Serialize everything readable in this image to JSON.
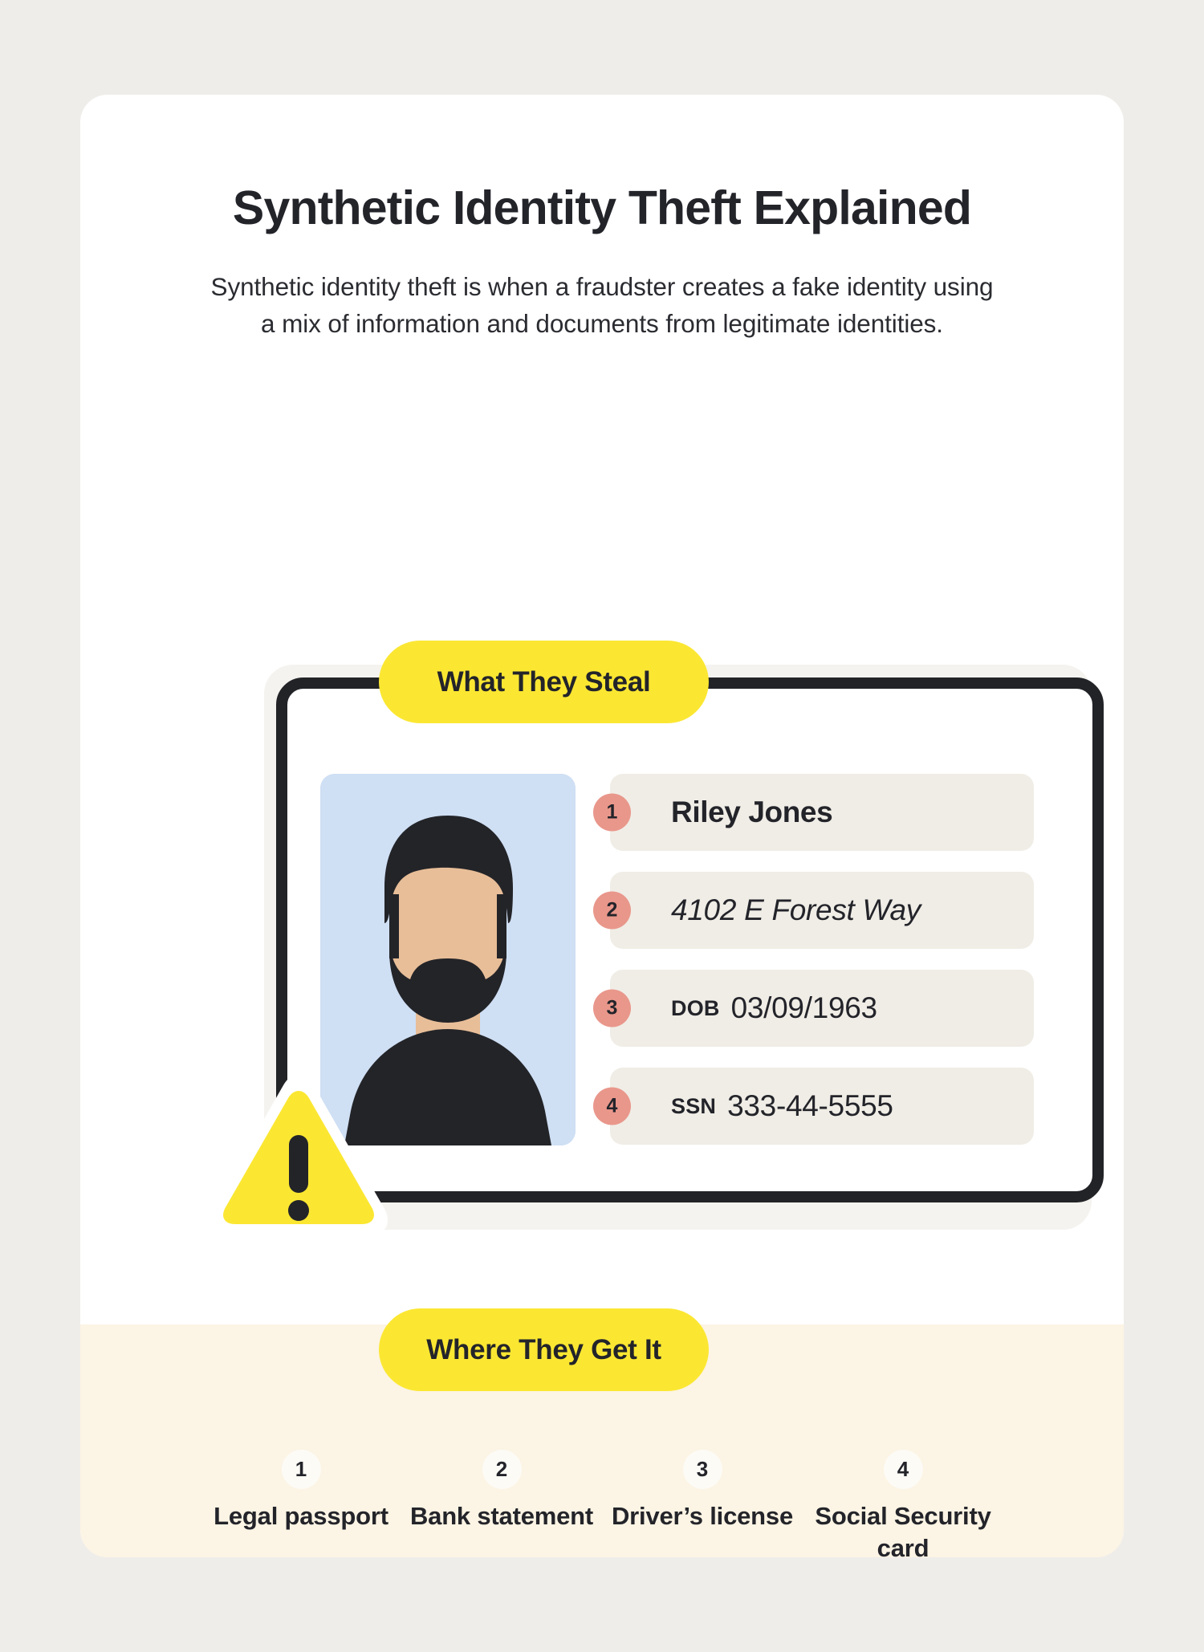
{
  "header": {
    "title": "Synthetic Identity Theft Explained",
    "subtitle": "Synthetic identity theft is when a fraudster creates a fake identity using a mix of information and documents from legitimate identities."
  },
  "sections": {
    "steal_badge": "What They Steal",
    "where_badge": "Where They Get It"
  },
  "id_card": {
    "rows": [
      {
        "num": "1",
        "type": "name",
        "label": "",
        "value": "Riley Jones"
      },
      {
        "num": "2",
        "type": "addr",
        "label": "",
        "value": "4102 E Forest Way"
      },
      {
        "num": "3",
        "type": "field",
        "label": "DOB",
        "value": "03/09/1963"
      },
      {
        "num": "4",
        "type": "field",
        "label": "SSN",
        "value": "333-44-5555"
      }
    ]
  },
  "sources": [
    {
      "num": "1",
      "label": "Legal passport"
    },
    {
      "num": "2",
      "label": "Bank statement"
    },
    {
      "num": "3",
      "label": "Driver’s license"
    },
    {
      "num": "4",
      "label": "Social Security card"
    }
  ],
  "colors": {
    "page_bg": "#EFEDE9",
    "card_bg": "#FFFFFF",
    "cream_band": "#FCF4E4",
    "accent_yellow": "#FBE732",
    "salmon": "#E9978B",
    "row_bg": "#F0EDE6",
    "photo_bg": "#CFDFF4",
    "skin": "#E8BE98",
    "hair": "#232428",
    "text_dark": "#23242A"
  },
  "icons": {
    "warning": "warning-triangle-icon",
    "avatar": "person-avatar-icon"
  }
}
